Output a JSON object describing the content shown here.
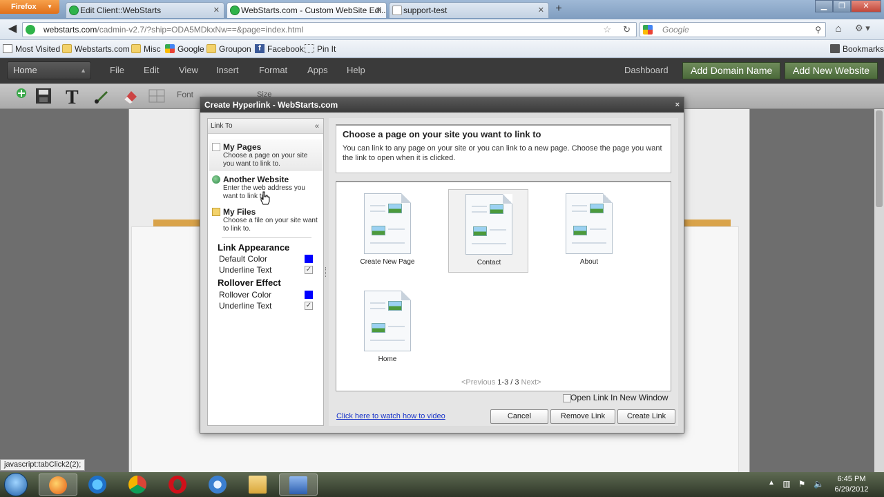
{
  "browser": {
    "app_button": "Firefox",
    "tabs": [
      {
        "label": "Edit Client::WebStarts"
      },
      {
        "label": "WebStarts.com - Custom WebSite Edi..."
      },
      {
        "label": "support-test"
      }
    ],
    "url_host": "webstarts.com",
    "url_path": "/cadmin-v2.7/?ship=ODA5MDkxNw==&page=index.html",
    "search_placeholder": "Google",
    "bookmarks": [
      {
        "label": "Most Visited",
        "icon": "page-icon"
      },
      {
        "label": "Webstarts.com",
        "icon": "folder-icon"
      },
      {
        "label": "Misc",
        "icon": "folder-icon"
      },
      {
        "label": "Google",
        "icon": "google-icon"
      },
      {
        "label": "Groupon",
        "icon": "folder-icon"
      },
      {
        "label": "Facebook",
        "icon": "facebook-icon"
      },
      {
        "label": "Pin It",
        "icon": "pin-icon"
      }
    ],
    "bookmarks_menu": "Bookmarks"
  },
  "app": {
    "page_select": "Home",
    "menus": [
      "File",
      "Edit",
      "View",
      "Insert",
      "Format",
      "Apps",
      "Help"
    ],
    "dashboard": "Dashboard",
    "add_domain": "Add Domain Name",
    "add_website": "Add New Website",
    "font_label": "Font",
    "size_label": "Size"
  },
  "dialog": {
    "title": "Create Hyperlink - WebStarts.com",
    "close": "×",
    "link_to_header": "Link To",
    "collapse": "«",
    "options": [
      {
        "title": "My Pages",
        "desc": "Choose a page on your site you want to link to."
      },
      {
        "title": "Another Website",
        "desc": "Enter the web address you want to link to."
      },
      {
        "title": "My Files",
        "desc": "Choose a file on your site want to link to."
      }
    ],
    "link_appearance": {
      "title": "Link Appearance",
      "default_color": "Default Color",
      "underline": "Underline Text",
      "color": "#0000ff"
    },
    "rollover": {
      "title": "Rollover Effect",
      "rollover_color": "Rollover Color",
      "underline": "Underline Text",
      "color": "#0000ff"
    },
    "checkmark": "✓",
    "info_title": "Choose a page on your site you want to link to",
    "info_text": "You can link to any page on your site or you can link to a new page. Choose the page you want the link to open when it is clicked.",
    "pages": [
      {
        "label": "Create New Page"
      },
      {
        "label": "Contact"
      },
      {
        "label": "About"
      },
      {
        "label": "Home"
      }
    ],
    "pager_prev": "<Previous",
    "pager_range": "1-3 / 3",
    "pager_next": "Next>",
    "new_window": "Open Link In New Window",
    "howto_link": "Click here to watch how to video",
    "cancel": "Cancel",
    "remove_link": "Remove Link",
    "create_link": "Create Link"
  },
  "status_text": "javascript:tabClick2(2);",
  "clock": {
    "time": "6:45 PM",
    "date": "6/29/2012"
  }
}
